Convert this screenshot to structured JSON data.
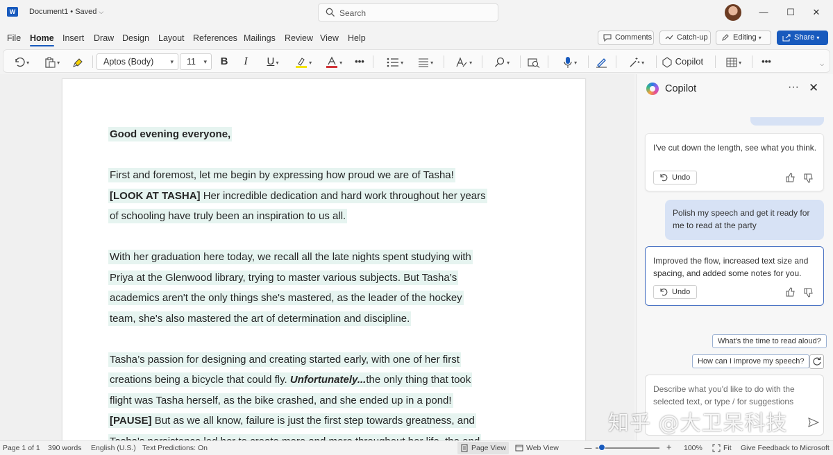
{
  "titlebar": {
    "app_icon": "word-icon",
    "app_letter": "W",
    "doc_title": "Document1 • Saved",
    "search_placeholder": "Search",
    "minimize": "—",
    "maximize": "☐",
    "close": "✕"
  },
  "menu": {
    "tabs": [
      "File",
      "Home",
      "Insert",
      "Draw",
      "Design",
      "Layout",
      "References",
      "Mailings",
      "Review",
      "View",
      "Help"
    ],
    "active": "Home",
    "comments": "Comments",
    "catchup": "Catch-up",
    "editing": "Editing",
    "share": "Share"
  },
  "ribbon": {
    "font_name": "Aptos (Body)",
    "font_size": "11",
    "bold": "B",
    "italic": "I",
    "underline": "U",
    "more": "•••",
    "copilot": "Copilot",
    "highlight_color": "#f5e400",
    "font_color": "#d13438"
  },
  "document": {
    "paragraphs": [
      [
        {
          "t": "Good evening everyone,",
          "s": "bold"
        }
      ],
      [],
      [
        {
          "t": "First and foremost, let me begin by expressing how proud we are of Tasha!"
        }
      ],
      [
        {
          "t": "[LOOK AT TASHA]",
          "s": "bold"
        },
        {
          "t": " Her incredible dedication and hard work throughout her years"
        }
      ],
      [
        {
          "t": "of schooling have truly been an inspiration to us all."
        }
      ],
      [],
      [
        {
          "t": "With her graduation here today, we recall all the late nights spent studying with"
        }
      ],
      [
        {
          "t": "Priya at the Glenwood library, trying to master various subjects. But Tasha’s"
        }
      ],
      [
        {
          "t": "academics aren't the only things she's mastered, as the leader of the hockey"
        }
      ],
      [
        {
          "t": "team, she's also mastered the art of determination and discipline."
        }
      ],
      [],
      [
        {
          "t": "Tasha’s passion for designing and creating started early, with one of her first"
        }
      ],
      [
        {
          "t": "creations being a bicycle that could fly. "
        },
        {
          "t": "Unfortunately...",
          "s": "bi"
        },
        {
          "t": "the only thing that took"
        }
      ],
      [
        {
          "t": "flight was Tasha herself, as the bike crashed, and she ended up in a pond!"
        }
      ],
      [
        {
          "t": "[PAUSE]",
          "s": "bold"
        },
        {
          "t": " But as we all know, failure is just the first step towards greatness, and"
        }
      ],
      [
        {
          "t": "Tasha's persistence led her to create more and more throughout her life, the end"
        }
      ]
    ]
  },
  "copilot": {
    "title": "Copilot",
    "more": "···",
    "close": "✕",
    "response1": "I've cut down the length, see what you think.",
    "undo1": "Undo",
    "user_prompt": "Polish my speech and get it ready for me to read at the party",
    "response2": "Improved the flow, increased text size and spacing, and added some notes for you.",
    "undo2": "Undo",
    "suggestion1": "What's the time to read aloud?",
    "suggestion2": "How can I improve my speech?",
    "composer_placeholder": "Describe what you'd like to do with the selected text, or type / for suggestions"
  },
  "watermark": "知乎 @大卫呆科技",
  "statusbar": {
    "page": "Page 1 of 1",
    "words": "390 words",
    "language": "English (U.S.)",
    "text_predictions": "Text Predictions: On",
    "page_view": "Page View",
    "web_view": "Web View",
    "zoom_minus": "—",
    "zoom_plus": "+",
    "zoom": "100%",
    "zoom_fraction": 0.1,
    "fit": "Fit",
    "feedback": "Give Feedback to Microsoft"
  }
}
